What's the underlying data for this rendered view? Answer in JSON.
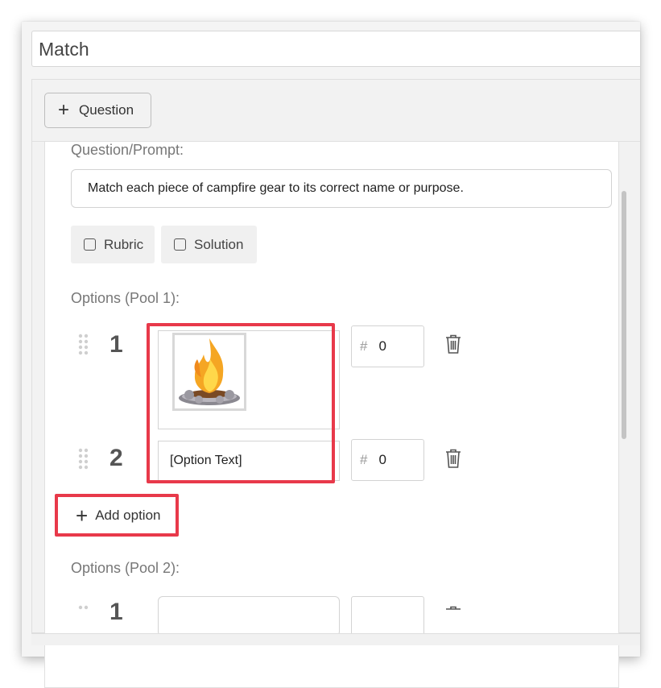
{
  "title_input": {
    "value": "Match"
  },
  "toolbar": {
    "add_question_label": "Question"
  },
  "question": {
    "prompt_label": "Question/Prompt:",
    "prompt_text": "Match each piece of campfire gear to its correct name or purpose.",
    "rubric_label": "Rubric",
    "solution_label": "Solution"
  },
  "pool1": {
    "label": "Options (Pool 1):",
    "options": [
      {
        "number": "1",
        "content_type": "image",
        "image": "campfire-image",
        "score": "0"
      },
      {
        "number": "2",
        "content_type": "text",
        "text": "[Option Text]",
        "score": "0"
      }
    ],
    "add_option_label": "Add option"
  },
  "pool2": {
    "label": "Options (Pool 2):",
    "options": [
      {
        "number": "1"
      }
    ]
  },
  "colors": {
    "highlight": "#e8394a",
    "flame_outer": "#f5a623",
    "flame_inner": "#ffd84a"
  }
}
